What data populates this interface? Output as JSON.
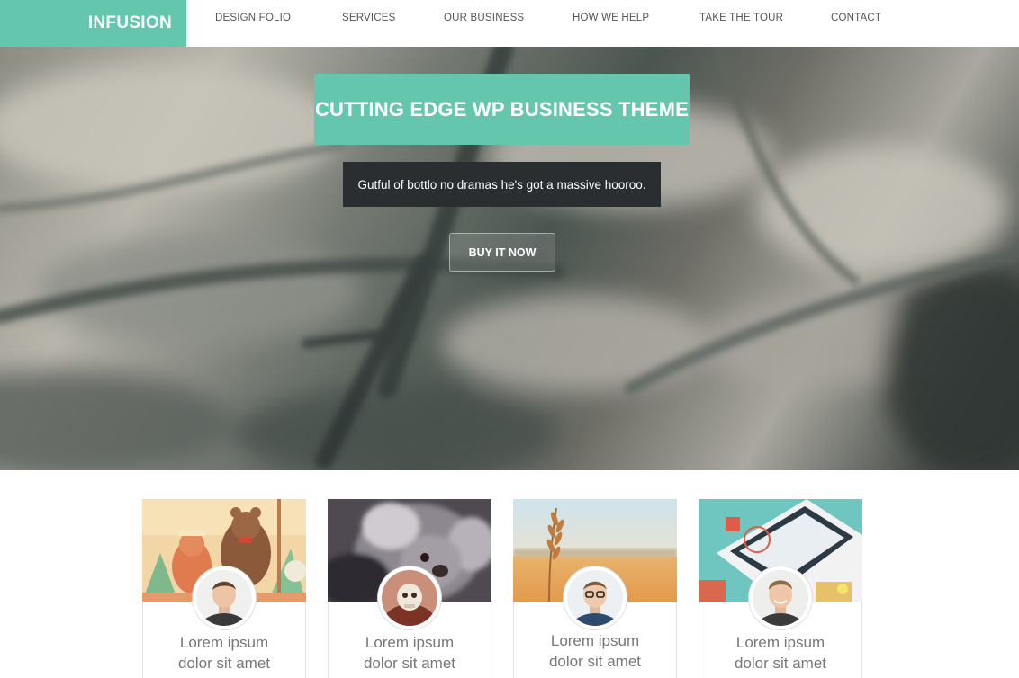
{
  "brand": {
    "name": "INFUSION",
    "color": "#63c6ad"
  },
  "nav": {
    "items": [
      {
        "label": "DESIGN FOLIO"
      },
      {
        "label": "SERVICES"
      },
      {
        "label": "OUR BUSINESS"
      },
      {
        "label": "HOW WE HELP"
      },
      {
        "label": "TAKE THE TOUR"
      },
      {
        "label": "CONTACT"
      }
    ]
  },
  "hero": {
    "title": "CUTTING EDGE WP BUSINESS THEME",
    "subtitle": "Gutful of bottlo no dramas he's got a massive hooroo.",
    "button_label": "BUY IT NOW"
  },
  "cards": [
    {
      "line1": "Lorem ipsum",
      "line2": "dolor sit amet"
    },
    {
      "line1": "Lorem ipsum",
      "line2": "dolor sit amet"
    },
    {
      "line1": "Lorem ipsum",
      "line2": "dolor sit amet"
    },
    {
      "line1": "Lorem ipsum",
      "line2": "dolor sit amet"
    }
  ]
}
